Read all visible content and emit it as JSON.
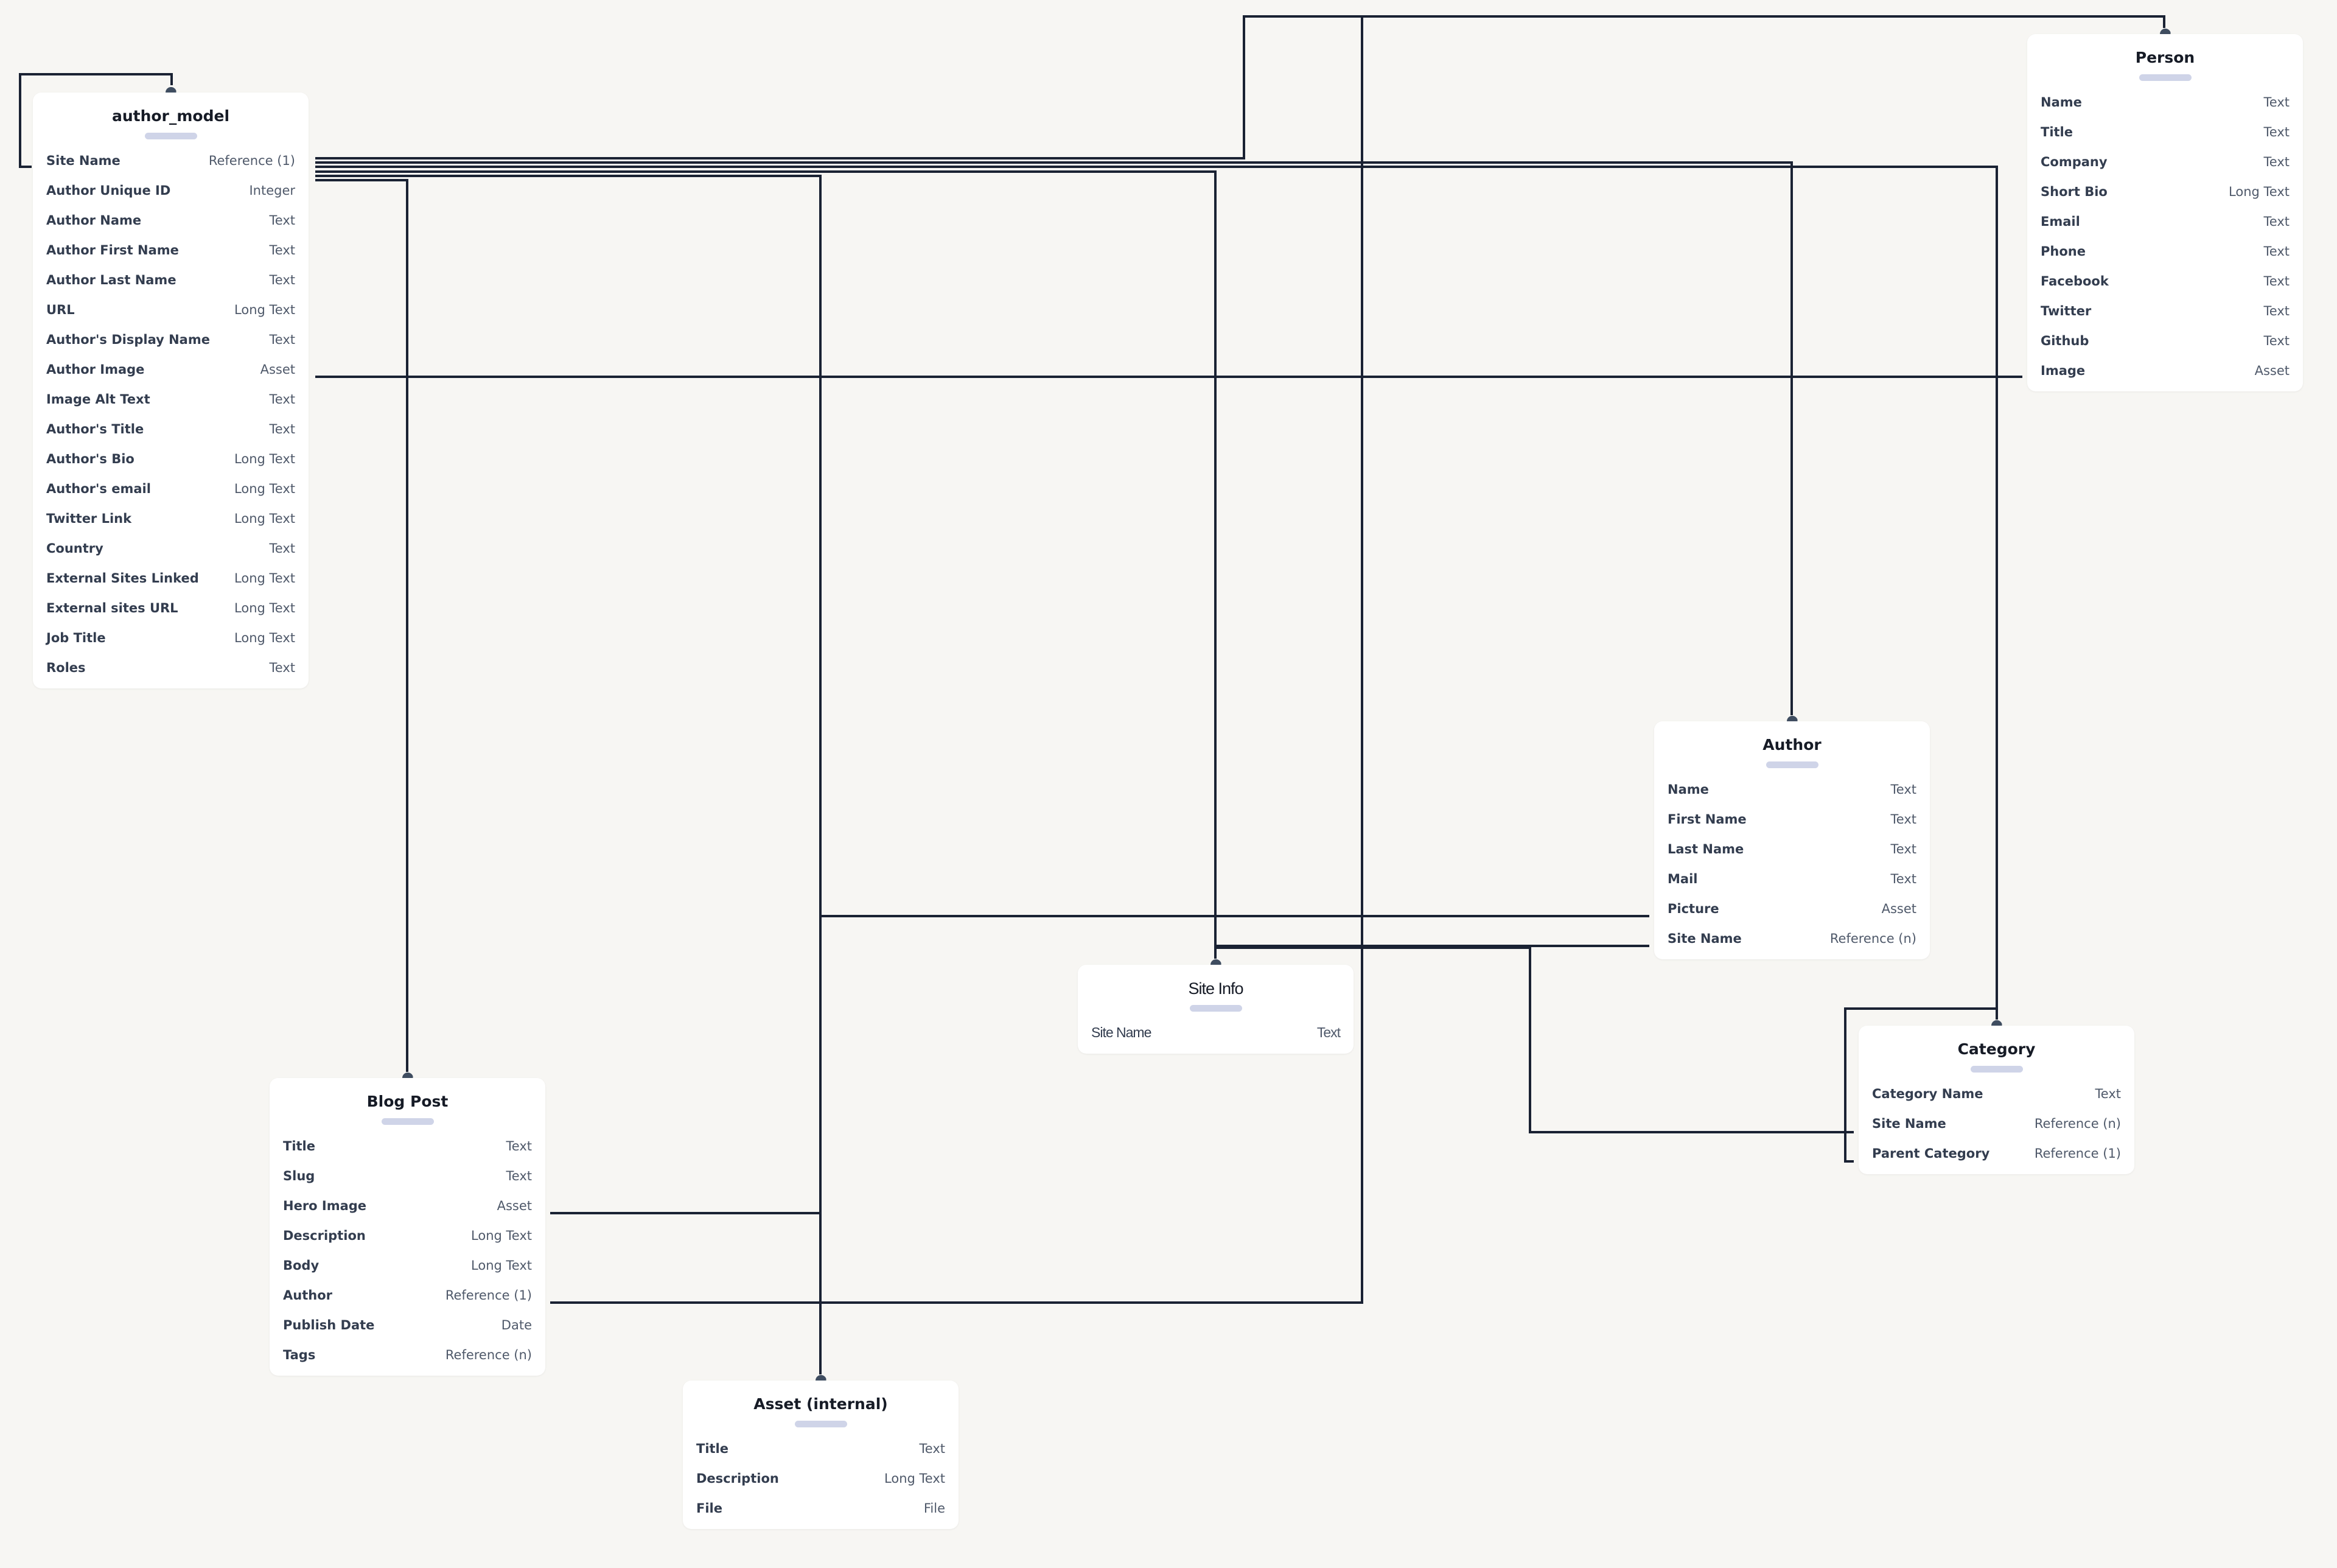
{
  "diagram": {
    "type": "schema-relationship-diagram",
    "models": [
      {
        "id": "author_model",
        "title": "author_model",
        "fields": [
          {
            "name": "Site Name",
            "type": "Reference (1)"
          },
          {
            "name": "Author Unique ID",
            "type": "Integer"
          },
          {
            "name": "Author Name",
            "type": "Text"
          },
          {
            "name": "Author First Name",
            "type": "Text"
          },
          {
            "name": "Author Last Name",
            "type": "Text"
          },
          {
            "name": "URL",
            "type": "Long Text"
          },
          {
            "name": "Author's Display Name",
            "type": "Text"
          },
          {
            "name": "Author Image",
            "type": "Asset"
          },
          {
            "name": "Image Alt Text",
            "type": "Text"
          },
          {
            "name": "Author's Title",
            "type": "Text"
          },
          {
            "name": "Author's Bio",
            "type": "Long Text"
          },
          {
            "name": "Author's email",
            "type": "Long Text"
          },
          {
            "name": "Twitter Link",
            "type": "Long Text"
          },
          {
            "name": "Country",
            "type": "Text"
          },
          {
            "name": "External Sites Linked",
            "type": "Long Text"
          },
          {
            "name": "External sites URL",
            "type": "Long Text"
          },
          {
            "name": "Job Title",
            "type": "Long Text"
          },
          {
            "name": "Roles",
            "type": "Text"
          }
        ]
      },
      {
        "id": "person",
        "title": "Person",
        "fields": [
          {
            "name": "Name",
            "type": "Text"
          },
          {
            "name": "Title",
            "type": "Text"
          },
          {
            "name": "Company",
            "type": "Text"
          },
          {
            "name": "Short Bio",
            "type": "Long Text"
          },
          {
            "name": "Email",
            "type": "Text"
          },
          {
            "name": "Phone",
            "type": "Text"
          },
          {
            "name": "Facebook",
            "type": "Text"
          },
          {
            "name": "Twitter",
            "type": "Text"
          },
          {
            "name": "Github",
            "type": "Text"
          },
          {
            "name": "Image",
            "type": "Asset"
          }
        ]
      },
      {
        "id": "author",
        "title": "Author",
        "fields": [
          {
            "name": "Name",
            "type": "Text"
          },
          {
            "name": "First Name",
            "type": "Text"
          },
          {
            "name": "Last Name",
            "type": "Text"
          },
          {
            "name": "Mail",
            "type": "Text"
          },
          {
            "name": "Picture",
            "type": "Asset"
          },
          {
            "name": "Site Name",
            "type": "Reference (n)"
          }
        ]
      },
      {
        "id": "site_info",
        "title": "Site Info",
        "fields": [
          {
            "name": "Site Name",
            "type": "Text"
          }
        ]
      },
      {
        "id": "category",
        "title": "Category",
        "fields": [
          {
            "name": "Category Name",
            "type": "Text"
          },
          {
            "name": "Site Name",
            "type": "Reference (n)"
          },
          {
            "name": "Parent Category",
            "type": "Reference (1)"
          }
        ]
      },
      {
        "id": "blog_post",
        "title": "Blog Post",
        "fields": [
          {
            "name": "Title",
            "type": "Text"
          },
          {
            "name": "Slug",
            "type": "Text"
          },
          {
            "name": "Hero Image",
            "type": "Asset"
          },
          {
            "name": "Description",
            "type": "Long Text"
          },
          {
            "name": "Body",
            "type": "Long Text"
          },
          {
            "name": "Author",
            "type": "Reference (1)"
          },
          {
            "name": "Publish Date",
            "type": "Date"
          },
          {
            "name": "Tags",
            "type": "Reference (n)"
          }
        ]
      },
      {
        "id": "asset_internal",
        "title": "Asset (internal)",
        "fields": [
          {
            "name": "Title",
            "type": "Text"
          },
          {
            "name": "Description",
            "type": "Long Text"
          },
          {
            "name": "File",
            "type": "File"
          }
        ]
      }
    ],
    "relations": [
      {
        "from": "author_model.Site Name",
        "to": "author_model"
      },
      {
        "from": "author_model.Site Name",
        "to": "person"
      },
      {
        "from": "author_model.Site Name",
        "to": "author"
      },
      {
        "from": "author_model.Site Name",
        "to": "category"
      },
      {
        "from": "author_model.Site Name",
        "to": "site_info"
      },
      {
        "from": "author_model.Site Name",
        "to": "asset_internal"
      },
      {
        "from": "author_model.Site Name",
        "to": "blog_post"
      },
      {
        "from": "author_model.Author Image",
        "to": "person.Image"
      },
      {
        "from": "author.Picture",
        "to": "asset_internal"
      },
      {
        "from": "author.Site Name",
        "to": "site_info"
      },
      {
        "from": "category.Site Name",
        "to": "site_info"
      },
      {
        "from": "category.Parent Category",
        "to": "category"
      },
      {
        "from": "blog_post.Hero Image",
        "to": "asset_internal"
      },
      {
        "from": "blog_post.Author",
        "to": "person"
      }
    ],
    "colors": {
      "background": "#f7f6f3",
      "card": "#ffffff",
      "connector": "#1a2233",
      "handle_bar": "#cfd4e8",
      "field_name": "#333d4f",
      "field_type": "#4f596a",
      "title": "#161b26"
    }
  }
}
